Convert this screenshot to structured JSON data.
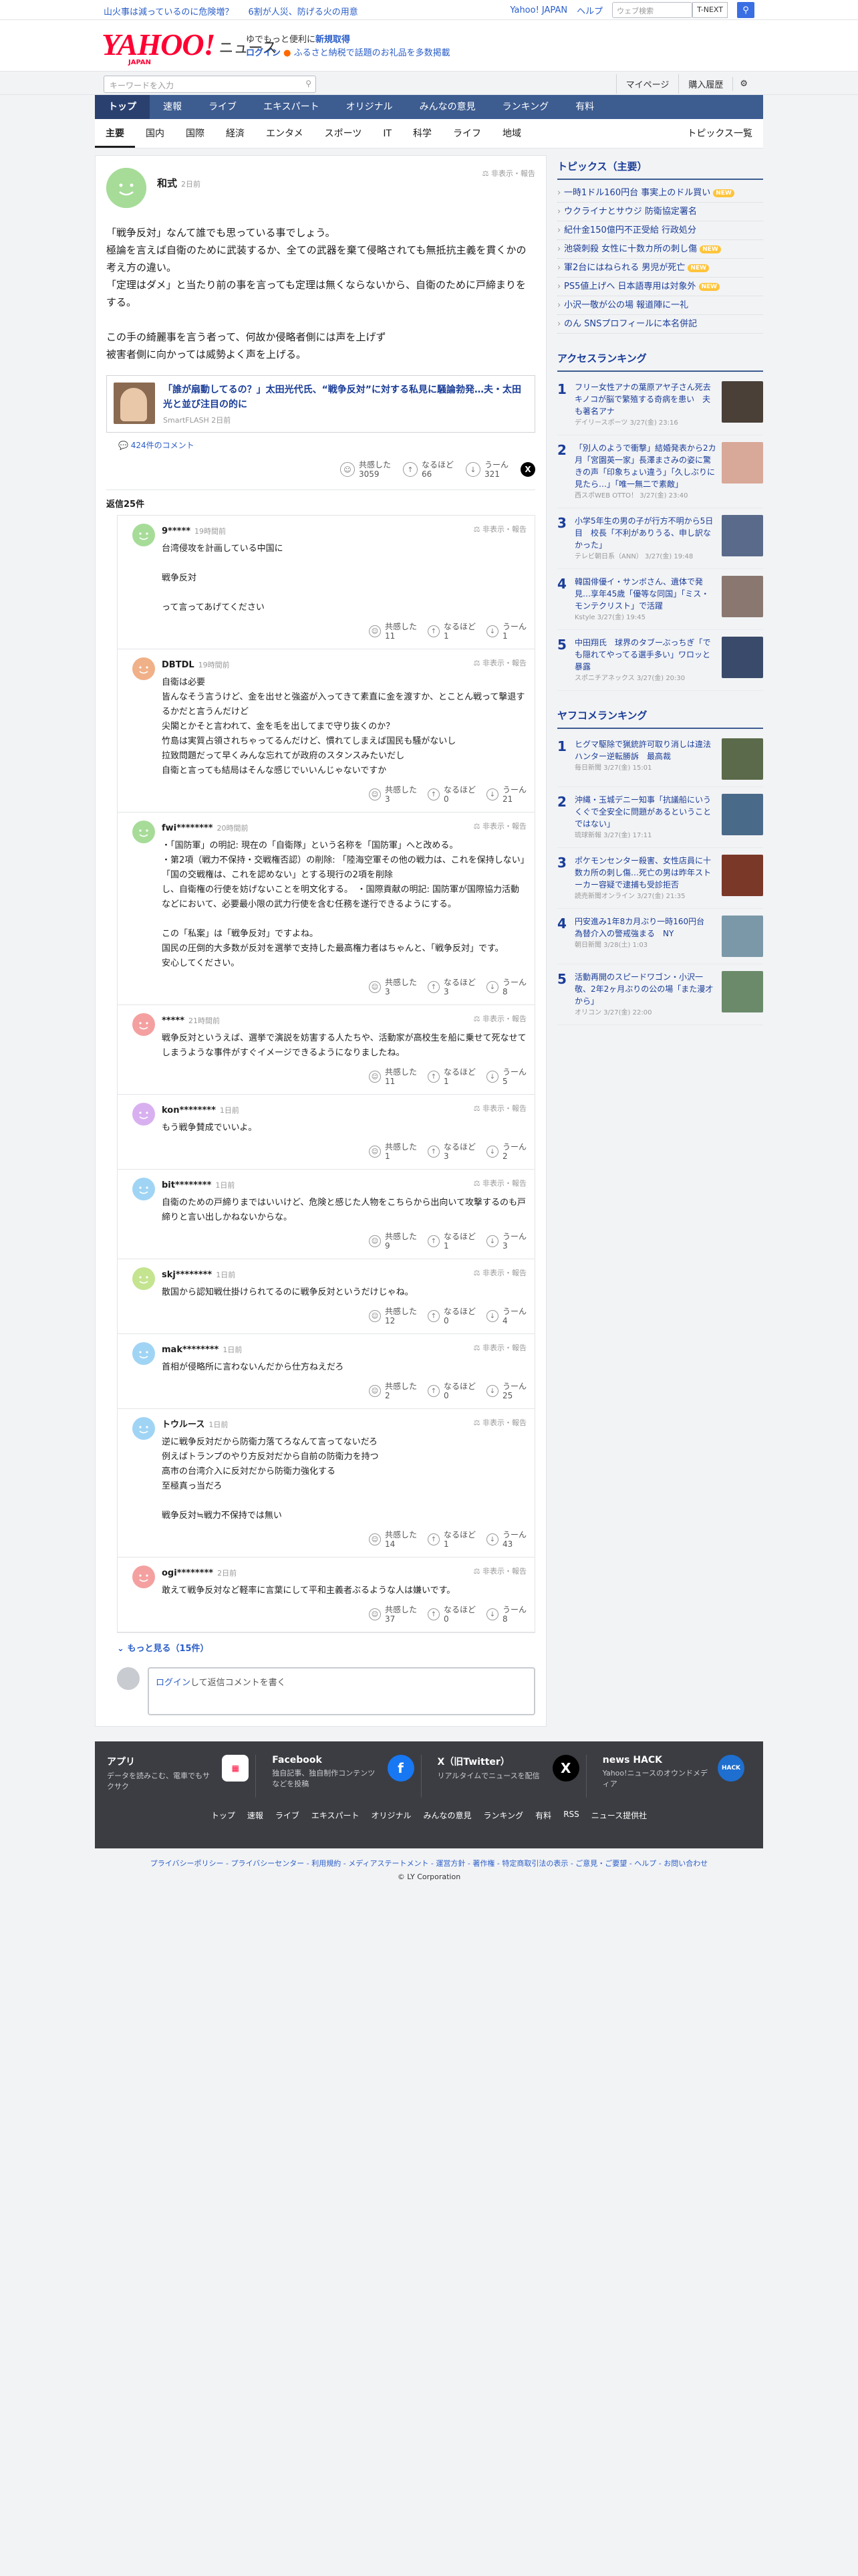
{
  "topstrip": {
    "left": [
      "山火事は減っているのに危険増？",
      "6割が人災、防げる火の用意"
    ],
    "right": [
      "Yahoo! JAPAN",
      "ヘルプ"
    ],
    "web_search_placeholder": "ウェブ検索",
    "tnext": "T-NEXT"
  },
  "header": {
    "logo_text": "YAHOO!",
    "logo_sub": "JAPAN",
    "logo_news": "ニュース",
    "promo_line1_a": "ゆでもっと便利に",
    "promo_line1_b": "新規取得",
    "promo_line2_a": "ログイン",
    "promo_line2_b": "ふるさと納税で話題のお礼品を多数掲載"
  },
  "searchbar": {
    "placeholder": "キーワードを入力",
    "mypage": "マイページ",
    "history": "購入履歴"
  },
  "nav1": [
    "トップ",
    "速報",
    "ライブ",
    "エキスパート",
    "オリジナル",
    "みんなの意見",
    "ランキング",
    "有料"
  ],
  "nav2": [
    "主要",
    "国内",
    "国際",
    "経済",
    "エンタメ",
    "スポーツ",
    "IT",
    "科学",
    "ライフ",
    "地域"
  ],
  "nav2_right": "トピックス一覧",
  "post": {
    "name": "和式",
    "time": "2日前",
    "hide": "非表示・報告",
    "text": [
      "「戦争反対」なんて誰でも思っている事でしょう。",
      "極論を言えば自衛のために武装するか、全ての武器を棄て侵略されても無抵抗主義を貫くかの考え方の違い。",
      "「定理はダメ」と当たり前の事を言っても定理は無くならないから、自衛のために戸締まりをする。",
      "",
      "この手の綺麗事を言う者って、何故か侵略者側には声を上げず",
      "被害者側に向かっては威勢よく声を上げる。"
    ],
    "link_title": "「誰が扇動してるの？」太田光代氏、“戦争反対”に対する私見に騒論勃発…夫・太田光と並び注目の的に",
    "link_source": "SmartFLASH 2日前",
    "link_comments": "424件のコメント",
    "react": {
      "agree_label": "共感した",
      "agree": "3059",
      "naruhodo_label": "なるほど",
      "naruhodo": "66",
      "uun_label": "うーん",
      "uun": "321"
    }
  },
  "reply_head_a": "返信",
  "reply_head_b": "25件",
  "replies": [
    {
      "name": "9*****",
      "time": "19時間前",
      "text": [
        "台湾侵攻を計画している中国に",
        "",
        "戦争反対",
        "",
        "って言ってあげてください"
      ],
      "r": [
        "11",
        "1",
        "1"
      ]
    },
    {
      "name": "DBTDL",
      "time": "19時間前",
      "text": [
        "自衛は必要",
        "皆んなそう言うけど、金を出せと強盗が入ってきて素直に金を渡すか、とことん戦って撃退するかだと言うんだけど",
        "尖閣とかそと言われて、金を毛を出してまで守り抜くのか？",
        "竹島は実質占領されちゃってるんだけど、慣れてしまえば国民も騒がないし",
        "拉致問題だって早くみんな忘れてが政府のスタンスみたいだし",
        "自衛と言っても結局はそんな感じでいいんじゃないですか"
      ],
      "r": [
        "3",
        "0",
        "21"
      ]
    },
    {
      "name": "fwi********",
      "time": "20時間前",
      "text": [
        "・「国防軍」の明記: 現在の「自衛隊」という名称を「国防軍」へと改める。",
        "・第2項（戦力不保持・交戦権否認）の削除: 「陸海空軍その他の戦力は、これを保持しない」「国の交戦権は、これを認めない」とする現行の2項を削除",
        "し、自衛権の行使を妨げないことを明文化する。　・国際貢献の明記: 国防軍が国際協力活動などにおいて、必要最小限の武力行使を含む任務を遂行できるようにする。",
        "",
        "この「私案」は「戦争反対」ですよね。",
        "国民の圧倒的大多数が反対を選挙で支持した最高権力者はちゃんと、「戦争反対」です。",
        "安心してください。"
      ],
      "r": [
        "3",
        "3",
        "8"
      ]
    },
    {
      "name": "*****",
      "time": "21時間前",
      "text": [
        "戦争反対というえば、選挙で演説を妨害する人たちや、活動家が高校生を船に乗せて死なせてしまうような事件がすぐイメージできるようになりましたね。"
      ],
      "r": [
        "11",
        "1",
        "5"
      ]
    },
    {
      "name": "kon********",
      "time": "1日前",
      "text": [
        "もう戦争賛成でいいよ。"
      ],
      "r": [
        "1",
        "3",
        "2"
      ]
    },
    {
      "name": "bit********",
      "time": "1日前",
      "text": [
        "自衛のための戸締りまではいいけど、危険と感じた人物をこちらから出向いて攻撃するのも戸締りと言い出しかねないからな。"
      ],
      "r": [
        "9",
        "1",
        "3"
      ]
    },
    {
      "name": "skj********",
      "time": "1日前",
      "text": [
        "散国から認知戦仕掛けられてるのに戦争反対というだけじゃね。"
      ],
      "r": [
        "12",
        "0",
        "4"
      ]
    },
    {
      "name": "mak********",
      "time": "1日前",
      "text": [
        "首相が侵略所に言わないんだから仕方ねえだろ"
      ],
      "r": [
        "2",
        "0",
        "25"
      ]
    },
    {
      "name": "トウルース",
      "time": "1日前",
      "text": [
        "逆に戦争反対だから防衛力落てろなんて言ってないだろ",
        "例えばトランプのやり方反対だから自前の防衛力を持つ",
        "高市の台湾介入に反対だから防衛力強化する",
        "至極真っ当だろ",
        "",
        "戦争反対≒戦力不保持では無い"
      ],
      "r": [
        "14",
        "1",
        "43"
      ]
    },
    {
      "name": "ogi********",
      "time": "2日前",
      "text": [
        "敢えて戦争反対など軽率に言葉にして平和主義者ぶるような人は嫌いです。"
      ],
      "r": [
        "37",
        "0",
        "8"
      ]
    }
  ],
  "reply_labels": {
    "agree": "共感した",
    "naruhodo": "なるほど",
    "uun": "うーん",
    "hide": "非表示・報告"
  },
  "more_a": "もっと見る",
  "more_b": "（15件）",
  "comment_box_a": "ログイン",
  "comment_box_b": "して返信コメントを書く",
  "side": {
    "topics_head": "トピックス（主要）",
    "topics": [
      {
        "t": "一時1ドル160円台 事実上のドル買い",
        "b": "NEW"
      },
      {
        "t": "ウクライナとサウジ 防衛協定署名",
        "b": ""
      },
      {
        "t": "紀什金150億円不正受給 行政処分",
        "b": ""
      },
      {
        "t": "池袋刺殺 女性に十数カ所の刺し傷",
        "b": "NEW"
      },
      {
        "t": "軍2台にはねられる 男児が死亡",
        "b": "NEW"
      },
      {
        "t": "PS5値上げへ 日本語専用は対象外",
        "b": "NEW"
      },
      {
        "t": "小沢一敬が公の場 報道陣に一礼",
        "b": ""
      },
      {
        "t": "のん SNSプロフィールに本名併記",
        "b": ""
      }
    ],
    "access_head": "アクセスランキング",
    "access": [
      {
        "n": "1",
        "t": "フリー女性アナの葉原アヤ子さん死去　キノコが脳で繁殖する奇病を患い　夫も著名アナ",
        "m": "デイリースポーツ 3/27(金) 23:16"
      },
      {
        "n": "2",
        "t": "「別人のようで衝撃」結婚発表から2カ月「宮園英一家」長澤まさみの姿に驚きの声「印象ちょい違う」「久しぶりに見たら…」「唯一無二で素敵」",
        "m": "西スポWEB OTTO！ 3/27(金) 23:40"
      },
      {
        "n": "3",
        "t": "小学5年生の男の子が行方不明から5日目　校長「不利がありうる、申し訳なかった」",
        "m": "テレビ朝日系（ANN） 3/27(金) 19:48"
      },
      {
        "n": "4",
        "t": "韓国俳優イ・サンボさん、遺体で発見…享年45歳「優等な同国」「ミス・モンテクリスト」で活躍",
        "m": "Kstyle 3/27(金) 19:45"
      },
      {
        "n": "5",
        "t": "中田翔氏　球界のタブーぶっちぎ「でも隠れてやってる選手多い」ワロッと暴露",
        "m": "スポニチアネックス 3/27(金) 20:30"
      }
    ],
    "comment_head": "ヤフコメランキング",
    "comment": [
      {
        "n": "1",
        "t": "ヒグマ駆除で猟銃許可取り消しは違法　ハンター逆転勝訴　最高裁",
        "m": "毎日新聞 3/27(金) 15:01"
      },
      {
        "n": "2",
        "t": "沖縄・玉城デニー知事「抗議船にいうくぐで全安全に問題があるということではない」",
        "m": "琉球新報 3/27(金) 17:11"
      },
      {
        "n": "3",
        "t": "ポケモンセンター殺害、女性店員に十数カ所の刺し傷…死亡の男は昨年ストーカー容疑で逮捕も受診拒否",
        "m": "読売新聞オンライン 3/27(金) 21:35"
      },
      {
        "n": "4",
        "t": "円安進み1年8カ月ぶり一時160円台　為替介入の警戒強まる　NY",
        "m": "朝日新聞 3/28(土) 1:03"
      },
      {
        "n": "5",
        "t": "活動再開のスピードワゴン・小沢一敬、2年2ヶ月ぶりの公の場「また漫才から」",
        "m": "オリコン 3/27(金) 22:00"
      }
    ]
  },
  "footer": {
    "cards": [
      {
        "t": "アプリ",
        "d": "データを読みこむ、電車でもサクサク"
      },
      {
        "t": "Facebook",
        "d": "独自記事、独自制作コンテンツなどを投稿"
      },
      {
        "t": "X（旧Twitter）",
        "d": "リアルタイムでニュースを配信"
      },
      {
        "t": "news HACK",
        "d": "Yahoo!ニュースのオウンドメディア"
      }
    ],
    "links": [
      "トップ",
      "速報",
      "ライブ",
      "エキスパート",
      "オリジナル",
      "みんなの意見",
      "ランキング",
      "有料",
      "RSS",
      "ニュース提供社"
    ],
    "legal": "プライバシーポリシー - プライバシーセンター - 利用規約 - メディアステートメント - 運営方針 - 著作権 - 特定商取引法の表示 - ご意見・ご要望 - ヘルプ - お問い合わせ",
    "copyright": "© LY Corporation"
  },
  "colors": {
    "accent": "#3d5c90",
    "link": "#1a3d98",
    "brand": "#ff0033"
  }
}
